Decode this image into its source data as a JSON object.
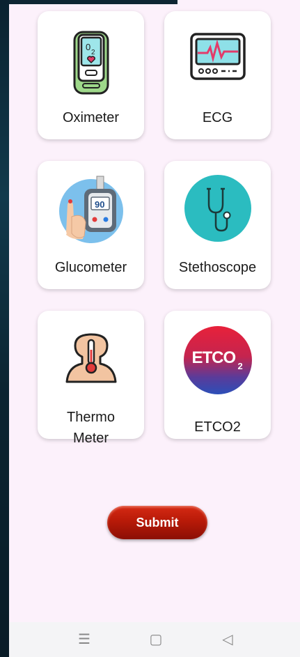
{
  "cards": [
    {
      "label": "Oximeter",
      "icon": "oximeter-icon",
      "accent": "#8fd17e"
    },
    {
      "label": "ECG",
      "icon": "ecg-monitor-icon",
      "accent": "#8ee0e8"
    },
    {
      "label": "Glucometer",
      "icon": "glucometer-icon",
      "reading": "90",
      "accent": "#5aa9e6"
    },
    {
      "label": "Stethoscope",
      "icon": "stethoscope-icon",
      "accent": "#2bbcc0"
    },
    {
      "label_line1": "Thermo",
      "label_line2": "Meter",
      "icon": "thermometer-icon",
      "accent": "#f2c4a1"
    },
    {
      "label": "ETCO2",
      "icon": "etco2-icon",
      "badge_text": "ETCO",
      "badge_sub": "2",
      "accent": "#d6204a"
    }
  ],
  "submit": {
    "label": "Submit",
    "color": "#b81a08"
  },
  "navbar": {
    "menu_icon": "☰",
    "home_icon": "▢",
    "back_icon": "◁"
  }
}
